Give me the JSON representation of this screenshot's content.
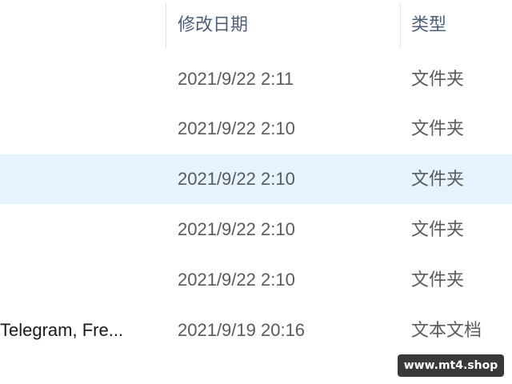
{
  "columns": {
    "date_modified": "修改日期",
    "type": "类型"
  },
  "rows": [
    {
      "name": "",
      "date": "2021/9/22 2:11",
      "type": "文件夹",
      "selected": false
    },
    {
      "name": "",
      "date": "2021/9/22 2:10",
      "type": "文件夹",
      "selected": false
    },
    {
      "name": "",
      "date": "2021/9/22 2:10",
      "type": "文件夹",
      "selected": true
    },
    {
      "name": "",
      "date": "2021/9/22 2:10",
      "type": "文件夹",
      "selected": false
    },
    {
      "name": "",
      "date": "2021/9/22 2:10",
      "type": "文件夹",
      "selected": false
    },
    {
      "name": "Telegram, Fre...",
      "date": "2021/9/19 20:16",
      "type": "文本文档",
      "selected": false
    }
  ],
  "watermark": "www.mt4.shop",
  "colors": {
    "selected_row": "#e5f3ff",
    "header_text": "#4c607a",
    "cell_text": "#5a5a5a"
  }
}
